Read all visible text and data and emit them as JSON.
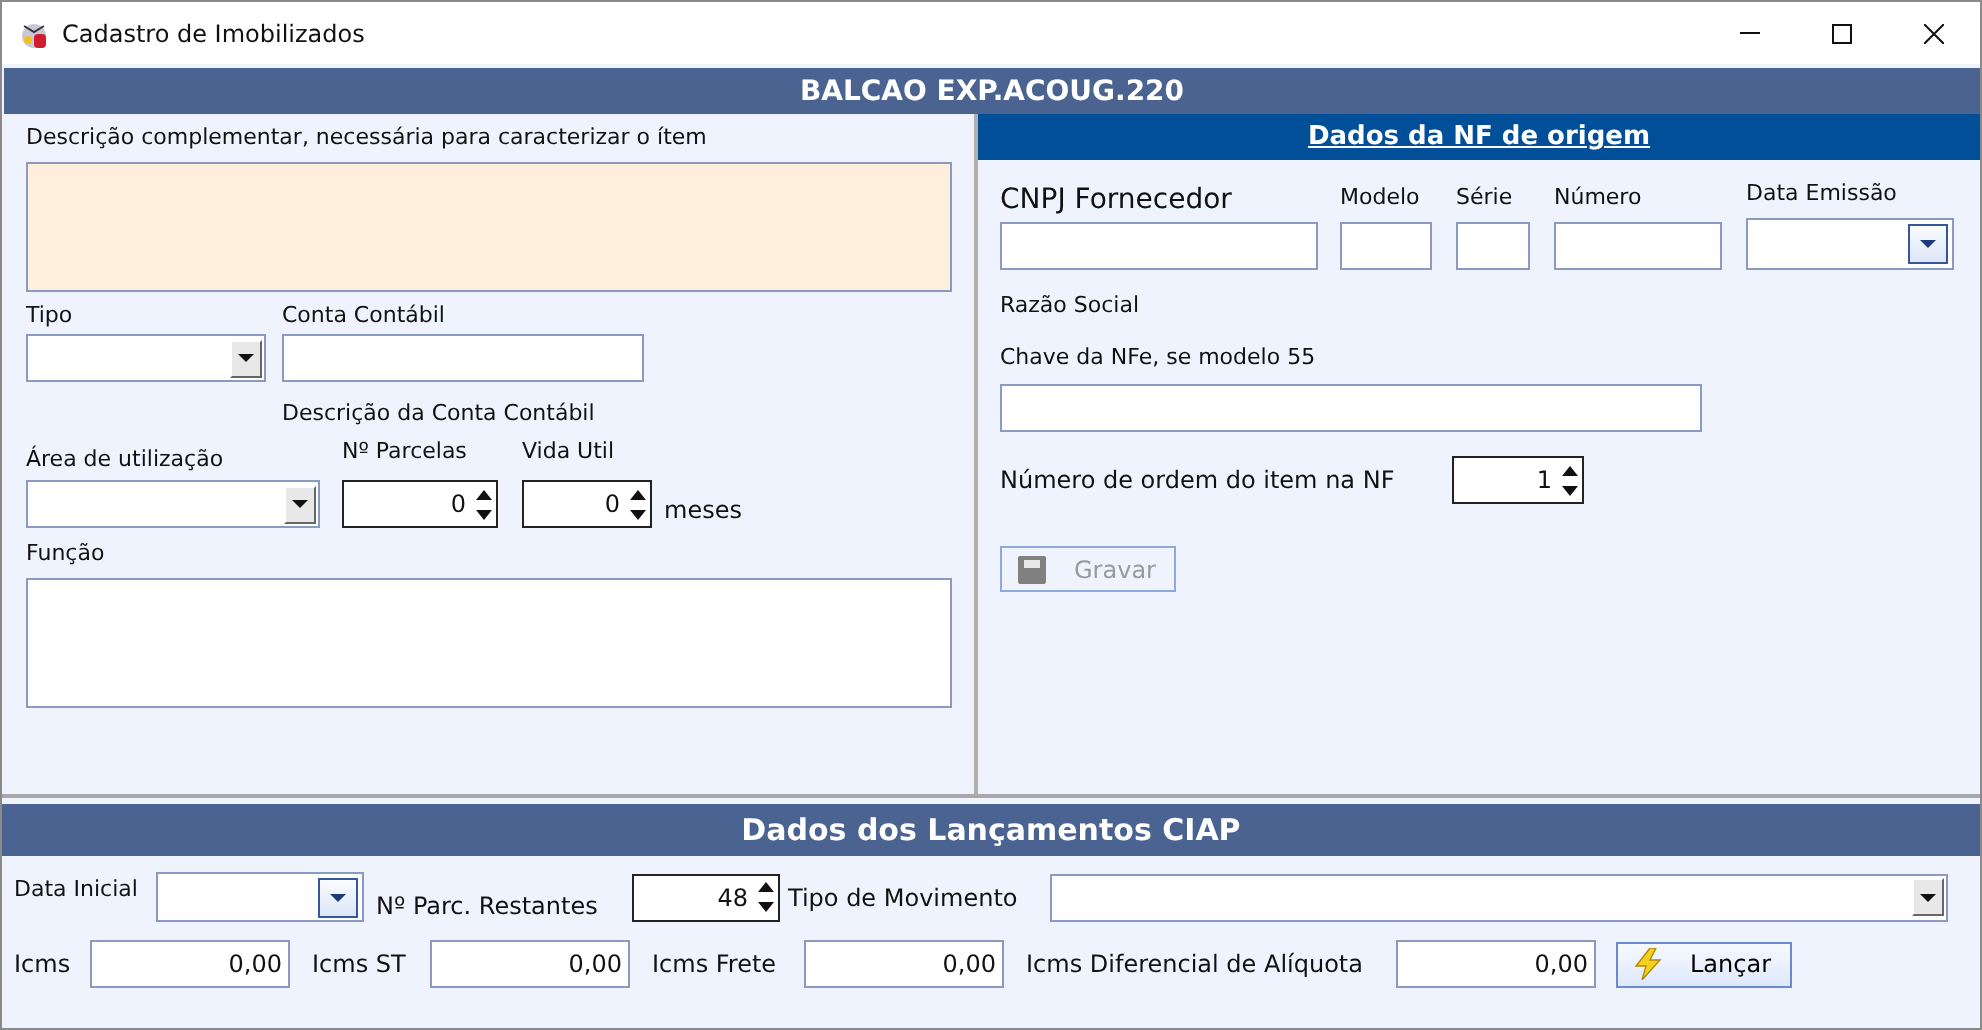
{
  "window": {
    "title": "Cadastro de Imobilizados"
  },
  "item_title": "BALCAO EXP.ACOUG.220",
  "item": {
    "description_label": "Descrição complementar, necessária para caracterizar o ítem",
    "tipo_label": "Tipo",
    "conta_label": "Conta Contábil",
    "conta_desc_label": "Descrição da Conta Contábil",
    "area_label": "Área de utilização",
    "parcelas": {
      "label": "Nº Parcelas",
      "value": "0"
    },
    "vida_util": {
      "label": "Vida Util",
      "value": "0",
      "unit": "meses"
    },
    "funcao_label": "Função"
  },
  "nf": {
    "title": "Dados da NF de origem",
    "fields": [
      {
        "label": "CNPJ Fornecedor",
        "kind": "text"
      },
      {
        "label": "Modelo",
        "kind": "text"
      },
      {
        "label": "Série",
        "kind": "text"
      },
      {
        "label": "Número",
        "kind": "text"
      },
      {
        "label": "Data Emissão",
        "kind": "date"
      }
    ],
    "razao_social_label": "Razão Social",
    "chave_label": "Chave da NFe, se modelo 55",
    "ordem": {
      "label": "Número de ordem do item na NF",
      "value": "1"
    },
    "save_button": {
      "label": "Gravar",
      "disabled": true
    }
  },
  "ciap": {
    "title": "Dados dos Lançamentos CIAP",
    "data_inicial_label": "Data Inicial",
    "parc_restantes": {
      "label": "Nº Parc. Restantes",
      "value": "48"
    },
    "tipo_movimento_label": "Tipo de Movimento",
    "amounts": [
      {
        "label": "Icms",
        "value": "0,00"
      },
      {
        "label": "Icms ST",
        "value": "0,00"
      },
      {
        "label": "Icms Frete",
        "value": "0,00"
      },
      {
        "label": "Icms Diferencial de Alíquota",
        "value": "0,00"
      }
    ],
    "launch_button": {
      "label": "Lançar",
      "disabled": false
    }
  }
}
